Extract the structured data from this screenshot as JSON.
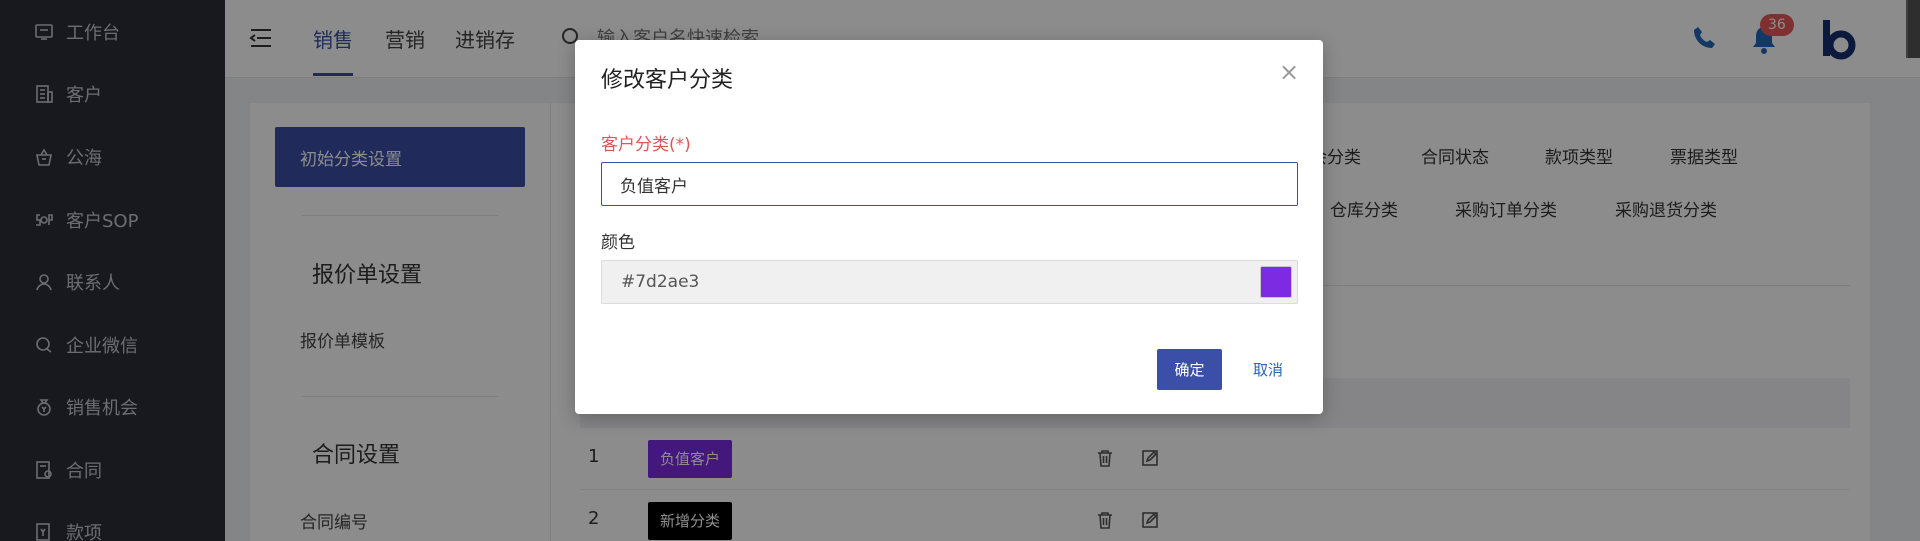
{
  "sidebar": {
    "items": [
      {
        "label": "工作台",
        "icon": "dashboard-icon"
      },
      {
        "label": "客户",
        "icon": "building-icon"
      },
      {
        "label": "公海",
        "icon": "basket-icon"
      },
      {
        "label": "客户SOP",
        "icon": "sop-icon"
      },
      {
        "label": "联系人",
        "icon": "person-icon"
      },
      {
        "label": "企业微信",
        "icon": "chat-icon"
      },
      {
        "label": "销售机会",
        "icon": "money-bag-icon"
      },
      {
        "label": "合同",
        "icon": "contract-icon"
      },
      {
        "label": "款项",
        "icon": "payment-icon"
      }
    ]
  },
  "header": {
    "tabs": [
      "销售",
      "营销",
      "进销存"
    ],
    "active_tab": "销售",
    "search_placeholder": "输入客户名快速检索",
    "notification_count": "36"
  },
  "left_panel": {
    "init_button": "初始分类设置",
    "sections": [
      {
        "title": "报价单设置",
        "items": [
          "报价单模板"
        ]
      },
      {
        "title": "合同设置",
        "items": [
          "合同编号"
        ]
      }
    ]
  },
  "category_tabs": {
    "row1": [
      "会分类",
      "合同状态",
      "款项类型",
      "票据类型"
    ],
    "row2": [
      "仓库分类",
      "采购订单分类",
      "采购退货分类"
    ]
  },
  "table": {
    "rows": [
      {
        "index": "1",
        "tag": "负值客户",
        "tag_color": "#7d2ae3"
      },
      {
        "index": "2",
        "tag": "新增分类",
        "tag_color": "#000000"
      }
    ]
  },
  "modal": {
    "title": "修改客户分类",
    "close_symbol": "×",
    "category_label": "客户分类(*)",
    "category_value": "负值客户",
    "color_label": "颜色",
    "color_value": "#7d2ae3",
    "confirm_label": "确定",
    "cancel_label": "取消"
  },
  "colors": {
    "primary": "#3b4fa8",
    "sidebar_bg": "#2a2f3a",
    "required_red": "#e05656",
    "link_blue": "#2466b8",
    "badge_red": "#e85a5a"
  }
}
